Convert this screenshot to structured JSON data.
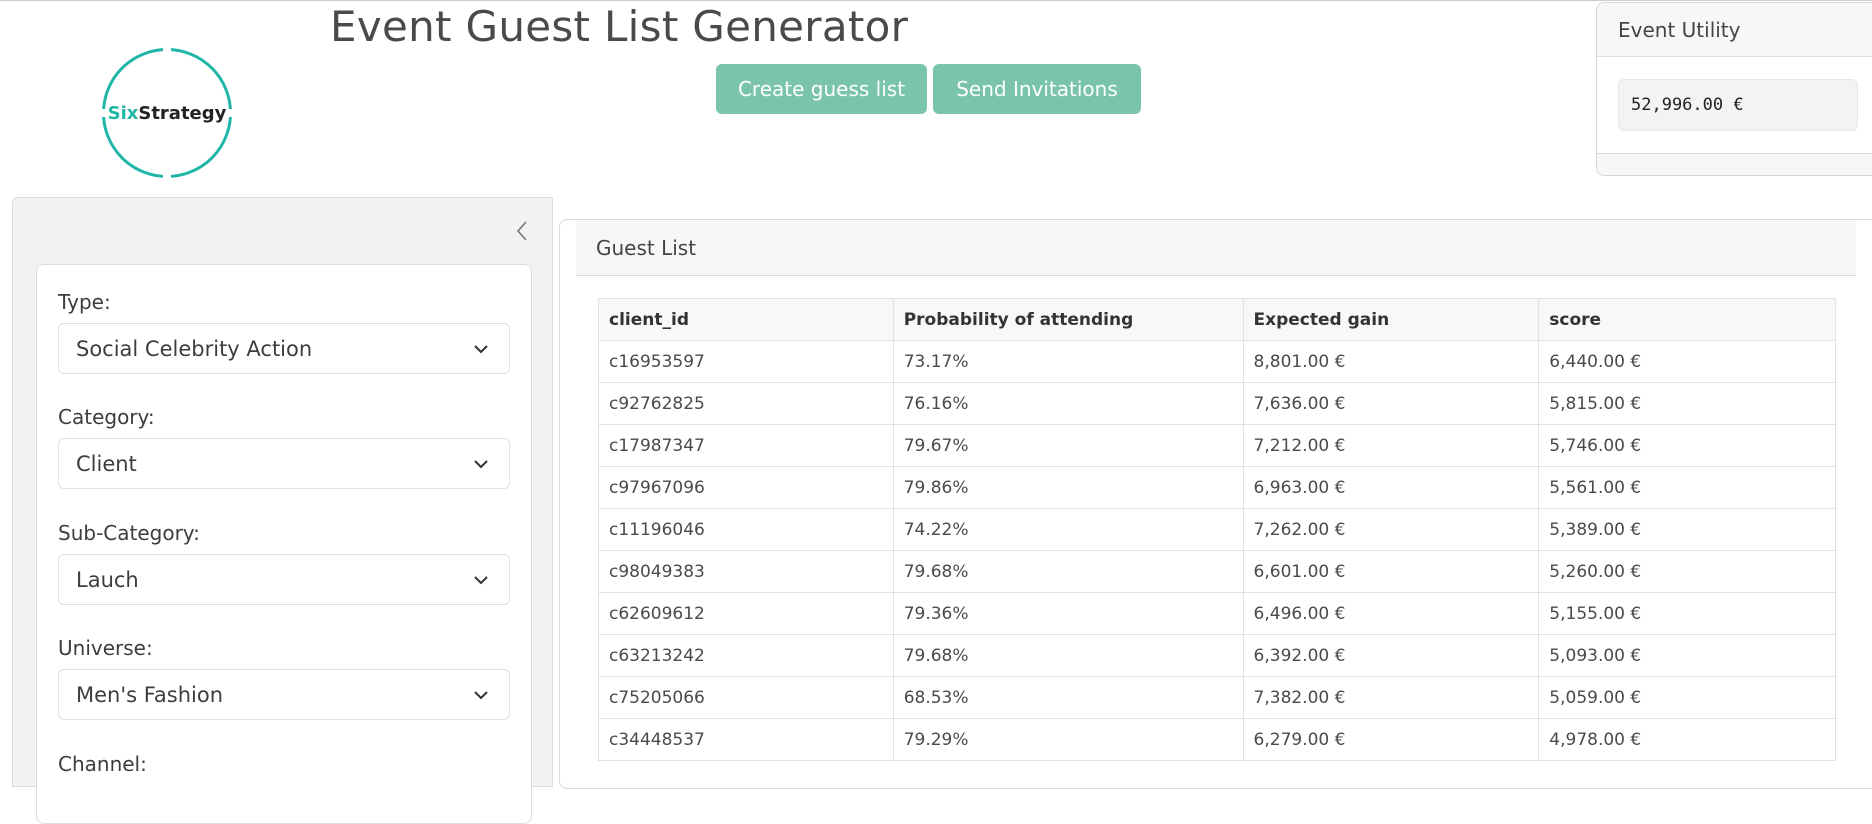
{
  "app": {
    "title": "Event Guest List Generator"
  },
  "logo": {
    "prefix": "Six",
    "suffix": "Strategy",
    "accent_color": "#20b6a6"
  },
  "actions": {
    "create_label": "Create guess list",
    "send_label": "Send Invitations",
    "button_color": "#7ac4ad"
  },
  "utility": {
    "title": "Event Utility",
    "value": "52,996.00 €"
  },
  "sidebar": {
    "collapse_icon": "chevron-left-icon",
    "filters": [
      {
        "label": "Type:",
        "value": "Social Celebrity Action"
      },
      {
        "label": "Category:",
        "value": "Client"
      },
      {
        "label": "Sub-Category:",
        "value": "Lauch"
      },
      {
        "label": "Universe:",
        "value": "Men's Fashion"
      },
      {
        "label": "Channel:",
        "value": ""
      }
    ]
  },
  "guest_list": {
    "title": "Guest List",
    "columns": [
      "client_id",
      "Probability of attending",
      "Expected gain",
      "score"
    ],
    "rows": [
      [
        "c16953597",
        "73.17%",
        "8,801.00 €",
        "6,440.00 €"
      ],
      [
        "c92762825",
        "76.16%",
        "7,636.00 €",
        "5,815.00 €"
      ],
      [
        "c17987347",
        "79.67%",
        "7,212.00 €",
        "5,746.00 €"
      ],
      [
        "c97967096",
        "79.86%",
        "6,963.00 €",
        "5,561.00 €"
      ],
      [
        "c11196046",
        "74.22%",
        "7,262.00 €",
        "5,389.00 €"
      ],
      [
        "c98049383",
        "79.68%",
        "6,601.00 €",
        "5,260.00 €"
      ],
      [
        "c62609612",
        "79.36%",
        "6,496.00 €",
        "5,155.00 €"
      ],
      [
        "c63213242",
        "79.68%",
        "6,392.00 €",
        "5,093.00 €"
      ],
      [
        "c75205066",
        "68.53%",
        "7,382.00 €",
        "5,059.00 €"
      ],
      [
        "c34448537",
        "79.29%",
        "6,279.00 €",
        "4,978.00 €"
      ]
    ]
  }
}
